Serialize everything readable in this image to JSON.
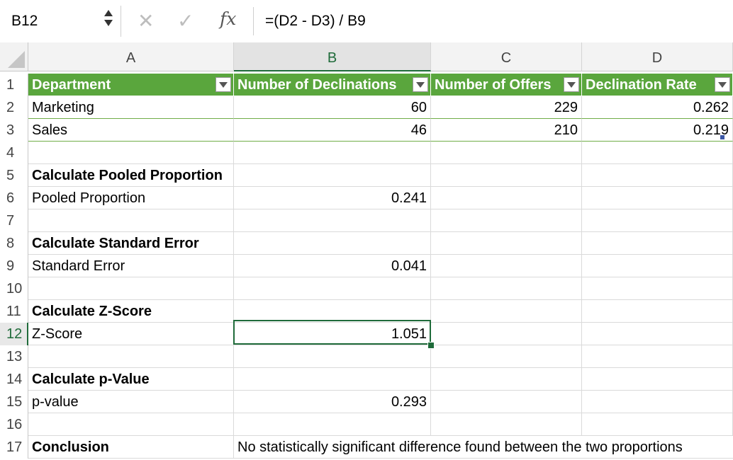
{
  "formula_bar": {
    "name_box": "B12",
    "cancel_icon": "✕",
    "enter_icon": "✓",
    "fx_label": "fx",
    "formula": "=(D2 - D3) / B9"
  },
  "columns": [
    "A",
    "B",
    "C",
    "D"
  ],
  "rows": [
    "1",
    "2",
    "3",
    "4",
    "5",
    "6",
    "7",
    "8",
    "9",
    "10",
    "11",
    "12",
    "13",
    "14",
    "15",
    "16",
    "17"
  ],
  "selected_cell": "B12",
  "table": {
    "headers": [
      "Department",
      "Number of Declinations",
      "Number of Offers",
      "Declination Rate"
    ],
    "body": [
      [
        "Marketing",
        "60",
        "229",
        "0.262"
      ],
      [
        "Sales",
        "46",
        "210",
        "0.219"
      ]
    ]
  },
  "sections": {
    "pooled_heading": "Calculate Pooled Proportion",
    "pooled_label": "Pooled Proportion",
    "pooled_value": "0.241",
    "se_heading": "Calculate Standard Error",
    "se_label": "Standard Error",
    "se_value": "0.041",
    "z_heading": "Calculate Z-Score",
    "z_label": "Z-Score",
    "z_value": "1.051",
    "p_heading": "Calculate p-Value",
    "p_label": "p-value",
    "p_value": "0.293",
    "conclusion_label": "Conclusion",
    "conclusion_text": "No statistically significant difference found between the two proportions"
  },
  "colors": {
    "table_header": "#5aa63d",
    "selection": "#1f6b3a"
  }
}
